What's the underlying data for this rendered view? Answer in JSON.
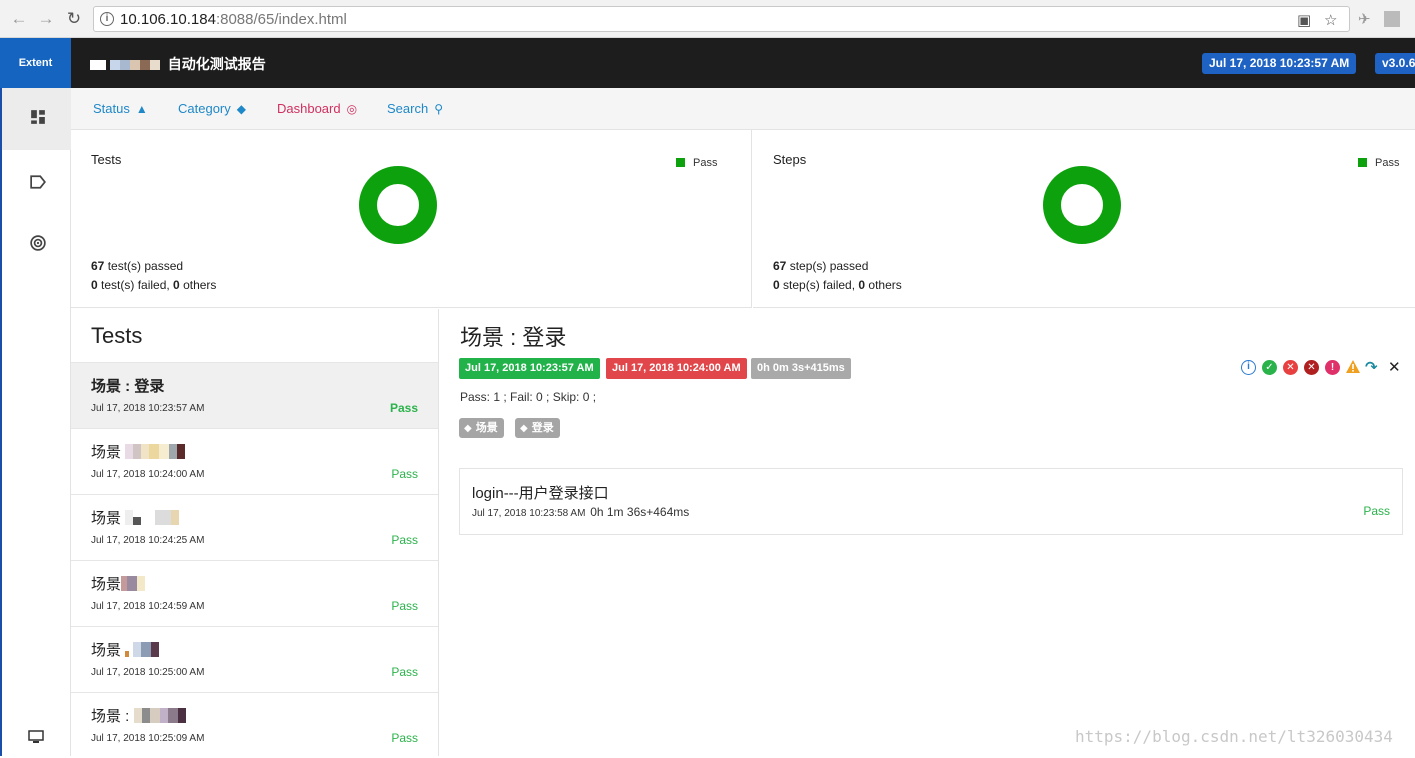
{
  "browser": {
    "url_host": "10.106.10.184",
    "url_rest": ":8088/65/index.html"
  },
  "header": {
    "brand": "Extent",
    "title": "自动化测试报告",
    "date_badge": "Jul 17, 2018 10:23:57 AM",
    "version_badge": "v3.0.6"
  },
  "tabs": [
    {
      "label": "Status",
      "icon": "warning-triangle-icon"
    },
    {
      "label": "Category",
      "icon": "tag-icon"
    },
    {
      "label": "Dashboard",
      "icon": "target-icon"
    },
    {
      "label": "Search",
      "icon": "search-icon"
    }
  ],
  "dashboard": {
    "tests_card": {
      "title": "Tests",
      "legend": "Pass",
      "passed_count": "67",
      "passed_text": " test(s) passed",
      "failed_count": "0",
      "failed_text": " test(s) failed, ",
      "others_count": "0",
      "others_text": " others"
    },
    "steps_card": {
      "title": "Steps",
      "legend": "Pass",
      "passed_count": "67",
      "passed_text": " step(s) passed",
      "failed_count": "0",
      "failed_text": " step(s) failed, ",
      "others_count": "0",
      "others_text": " others"
    }
  },
  "tests_list": {
    "heading": "Tests",
    "items": [
      {
        "name": "场景 : 登录",
        "time": "Jul 17, 2018 10:23:57 AM",
        "status": "Pass"
      },
      {
        "name": "场景",
        "time": "Jul 17, 2018 10:24:00 AM",
        "status": "Pass"
      },
      {
        "name": "场景",
        "time": "Jul 17, 2018 10:24:25 AM",
        "status": "Pass"
      },
      {
        "name": "场景",
        "time": "Jul 17, 2018 10:24:59 AM",
        "status": "Pass"
      },
      {
        "name": "场景",
        "time": "Jul 17, 2018 10:25:00 AM",
        "status": "Pass"
      },
      {
        "name": "场景 :",
        "time": "Jul 17, 2018 10:25:09 AM",
        "status": "Pass"
      }
    ]
  },
  "detail": {
    "title": "场景 : 登录",
    "start_time": "Jul 17, 2018 10:23:57 AM",
    "end_time": "Jul 17, 2018 10:24:00 AM",
    "duration": "0h 0m 3s+415ms",
    "counts": "Pass: 1 ; Fail: 0 ; Skip: 0 ;",
    "tags": [
      "场景",
      "登录"
    ],
    "node": {
      "name": "login---用户登录接口",
      "time": "Jul 17, 2018 10:23:58 AM",
      "duration": "0h 1m 36s+464ms",
      "status": "Pass"
    }
  },
  "colors": {
    "brand": "#1565c0",
    "pass": "#0ea10e",
    "start_badge": "#21b24a",
    "end_badge": "#e0464a",
    "duration_badge": "#a9a9a9"
  },
  "watermark": "https://blog.csdn.net/lt326030434"
}
